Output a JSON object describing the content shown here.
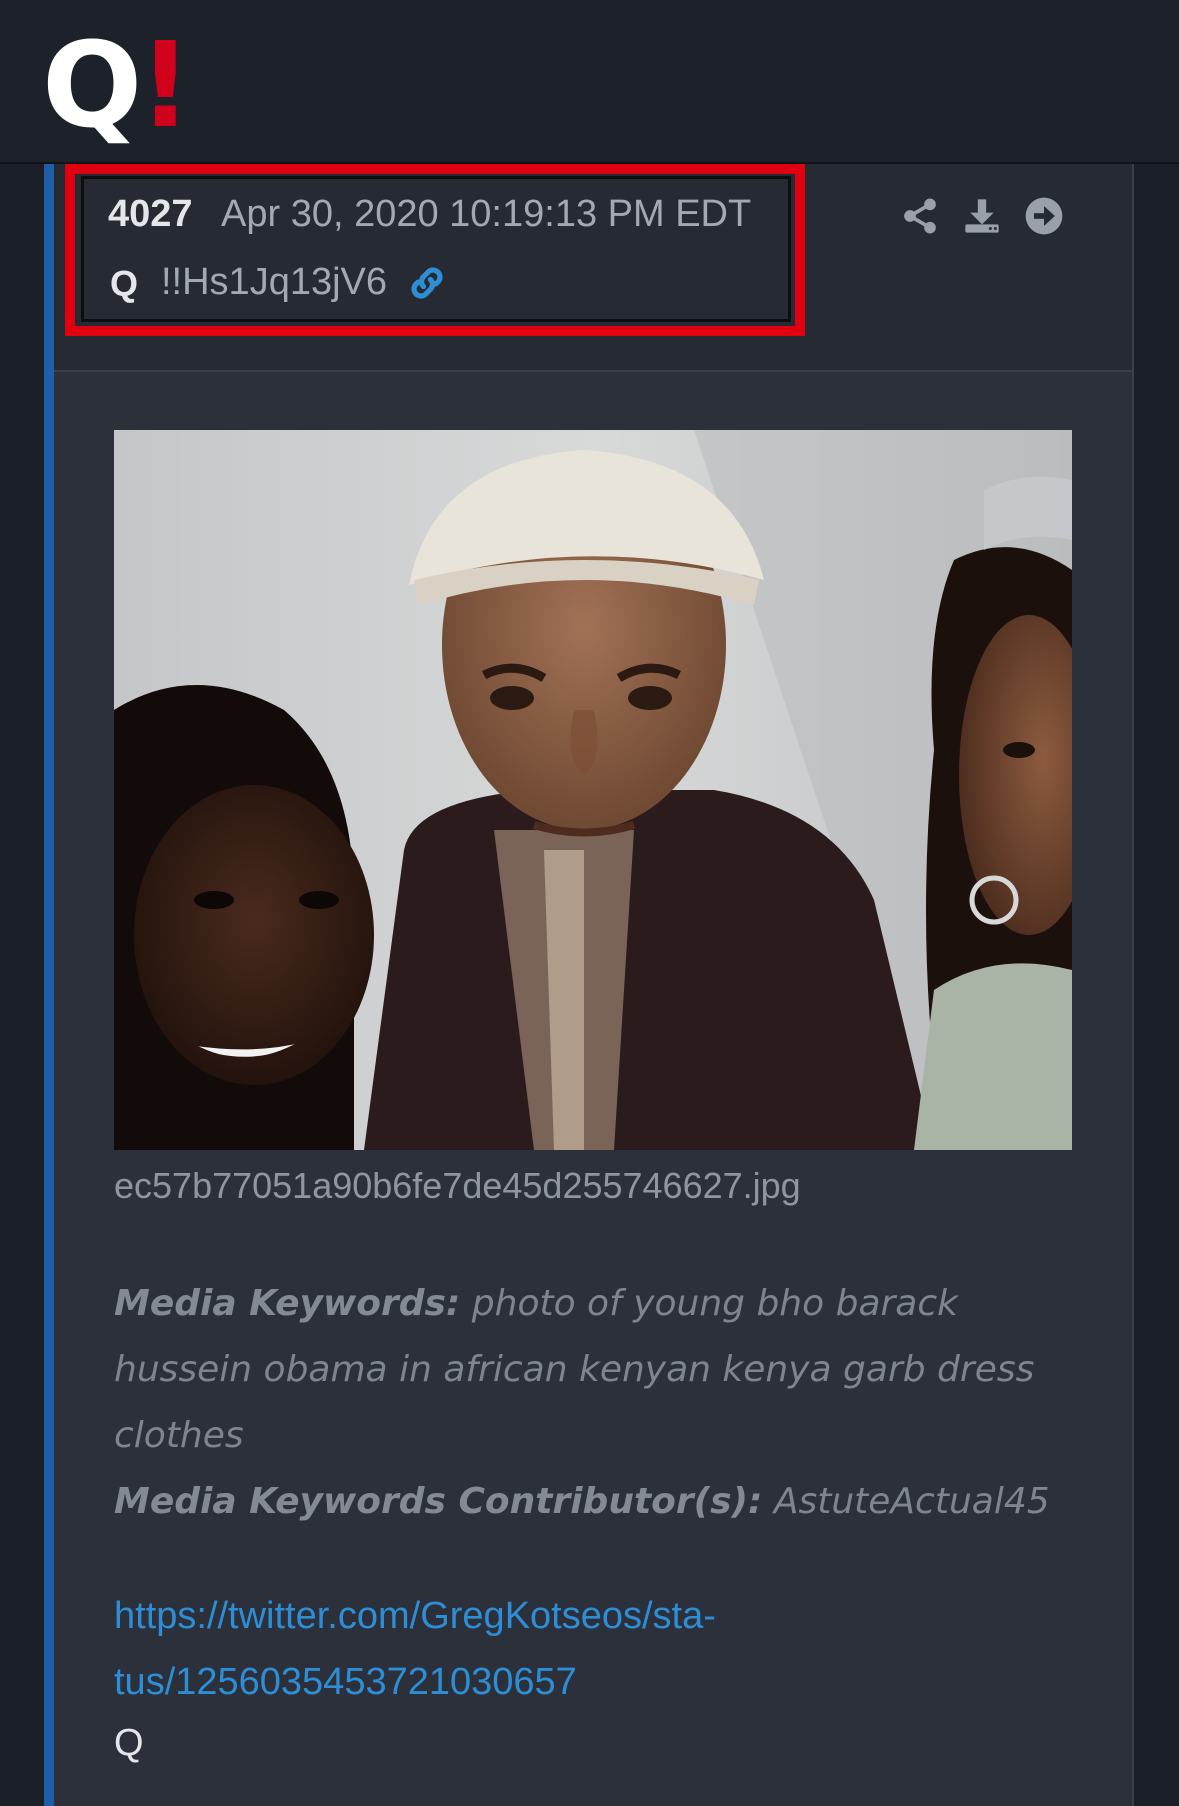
{
  "app": {
    "logo_letter": "Q",
    "logo_mark": "!"
  },
  "post": {
    "number": "4027",
    "date": "Apr 30, 2020 10:19:13 PM EDT",
    "author": "Q",
    "tripcode": "!!Hs1Jq13jV6",
    "icons": [
      "link-icon",
      "share-icon",
      "download-icon",
      "arrow-right-icon"
    ],
    "image": {
      "filename": "ec57b77051a90b6fe7de45d255746627.jpg"
    },
    "keywords": {
      "label": "Media Keywords:",
      "text": "photo of young bho barack hussein obama in african kenyan kenya garb dress clothes",
      "line1": "photo of young bho barack",
      "line2": "hussein obama in african kenyan kenya garb dress",
      "line3": "clothes",
      "contributor_label": "Media Keywords Contributor(s):",
      "contributor": "AstuteActual45"
    },
    "link": {
      "line1": "https://twitter.com/GregKotseos/sta-",
      "line2": "tus/1256035453721030657"
    },
    "signature": "Q"
  },
  "colors": {
    "background": "#1b1f27",
    "accent": "#1f5ea8",
    "highlight": "#e1000f",
    "link": "#2d8ed6"
  }
}
